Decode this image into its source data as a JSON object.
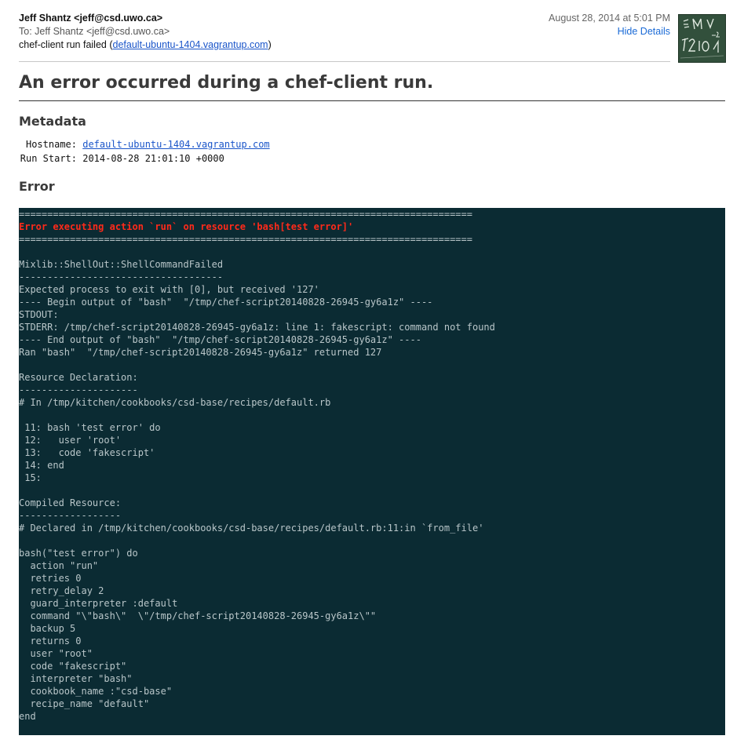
{
  "email": {
    "from": "Jeff Shantz <jeff@csd.uwo.ca>",
    "to_label": "To:",
    "to": "Jeff Shantz <jeff@csd.uwo.ca>",
    "subject_prefix": "chef-client run failed (",
    "subject_link": "default-ubuntu-1404.vagrantup.com",
    "subject_suffix": ")",
    "date": "August 28, 2014 at 5:01 PM",
    "hide_details": "Hide Details"
  },
  "report": {
    "title": "An error occurred during a chef-client run.",
    "metadata_heading": "Metadata",
    "hostname_label": "Hostname:",
    "hostname_value": "default-ubuntu-1404.vagrantup.com",
    "run_start_label": "Run Start:",
    "run_start_value": "2014-08-28 21:01:10 +0000",
    "error_heading": "Error"
  },
  "terminal": {
    "lines": [
      "================================================================================",
      "Error executing action `run` on resource 'bash[test error]'",
      "================================================================================",
      "",
      "Mixlib::ShellOut::ShellCommandFailed",
      "------------------------------------",
      "Expected process to exit with [0], but received '127'",
      "---- Begin output of \"bash\"  \"/tmp/chef-script20140828-26945-gy6a1z\" ----",
      "STDOUT:",
      "STDERR: /tmp/chef-script20140828-26945-gy6a1z: line 1: fakescript: command not found",
      "---- End output of \"bash\"  \"/tmp/chef-script20140828-26945-gy6a1z\" ----",
      "Ran \"bash\"  \"/tmp/chef-script20140828-26945-gy6a1z\" returned 127",
      "",
      "Resource Declaration:",
      "---------------------",
      "# In /tmp/kitchen/cookbooks/csd-base/recipes/default.rb",
      "",
      " 11: bash 'test error' do",
      " 12:   user 'root'",
      " 13:   code 'fakescript'",
      " 14: end",
      " 15:",
      "",
      "Compiled Resource:",
      "------------------",
      "# Declared in /tmp/kitchen/cookbooks/csd-base/recipes/default.rb:11:in `from_file'",
      "",
      "bash(\"test error\") do",
      "  action \"run\"",
      "  retries 0",
      "  retry_delay 2",
      "  guard_interpreter :default",
      "  command \"\\\"bash\\\"  \\\"/tmp/chef-script20140828-26945-gy6a1z\\\"\"",
      "  backup 5",
      "  returns 0",
      "  user \"root\"",
      "  code \"fakescript\"",
      "  interpreter \"bash\"",
      "  cookbook_name :\"csd-base\"",
      "  recipe_name \"default\"",
      "end"
    ],
    "error_line_index": 1
  },
  "colors": {
    "terminal_bg": "#0b2b33",
    "terminal_text": "#b9c6c9",
    "error_text": "#ff2a1a",
    "link": "#1a55c9"
  }
}
